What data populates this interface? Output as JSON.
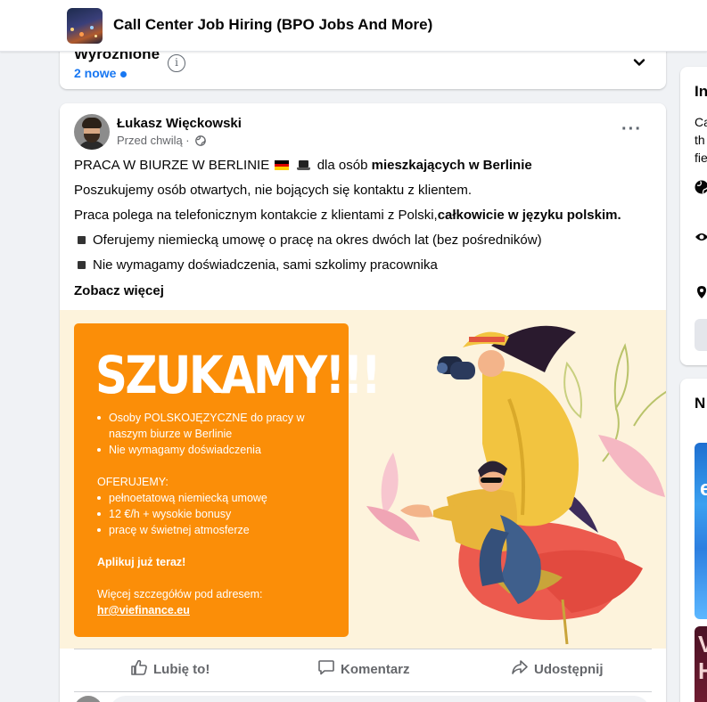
{
  "header": {
    "group_title": "Call Center Job Hiring (BPO Jobs And More)"
  },
  "featured": {
    "title": "Wyróżnione",
    "new_count": "2 nowe"
  },
  "post": {
    "author": "Łukasz Więckowski",
    "time": "Przed chwilą ·",
    "line1_prefix": "PRACA W BIURZE W BERLINIE",
    "line1_mid": "dla osób",
    "line1_bold": "mieszkających w Berlinie",
    "line2": "Poszukujemy osób otwartych, nie bojących się kontaktu z klientem.",
    "line3_prefix": "Praca polega na telefonicznym kontakcie z klientami z Polski,",
    "line3_bold": "całkowicie w języku polskim.",
    "bullet1": "Oferujemy niemiecką umowę o pracę na okres dwóch lat (bez pośredników)",
    "bullet2": "Nie wymagamy doświadczenia, sami szkolimy pracownika",
    "see_more": "Zobacz więcej"
  },
  "image": {
    "headline": "SZUKAMY!!!",
    "bullets": [
      "Osoby POLSKOJĘZYCZNE do pracy w",
      "naszym biurze w Berlinie",
      "Nie wymagamy doświadczenia"
    ],
    "offer_label": "OFERUJEMY:",
    "offer_items": [
      "pełnoetatową niemiecką umowę",
      "12 €/h + wysokie bonusy",
      "pracę w świetnej atmosferze"
    ],
    "apply": "Aplikuj już teraz!",
    "details": "Więcej szczegółów pod adresem:",
    "email": "hr@viefinance.eu"
  },
  "actions": {
    "like": "Lubię to!",
    "comment": "Komentarz",
    "share": "Udostępnij"
  },
  "right_panel": {
    "info_heading": "In",
    "info_lines": [
      "Ca",
      "th",
      "fie"
    ],
    "second_heading": "N",
    "thumb1_text": "eb",
    "thumb2_lines": [
      "V",
      "H"
    ]
  },
  "colors": {
    "brand_blue": "#1877f2",
    "orange": "#fb8e08",
    "cream": "#fdf3dc"
  }
}
